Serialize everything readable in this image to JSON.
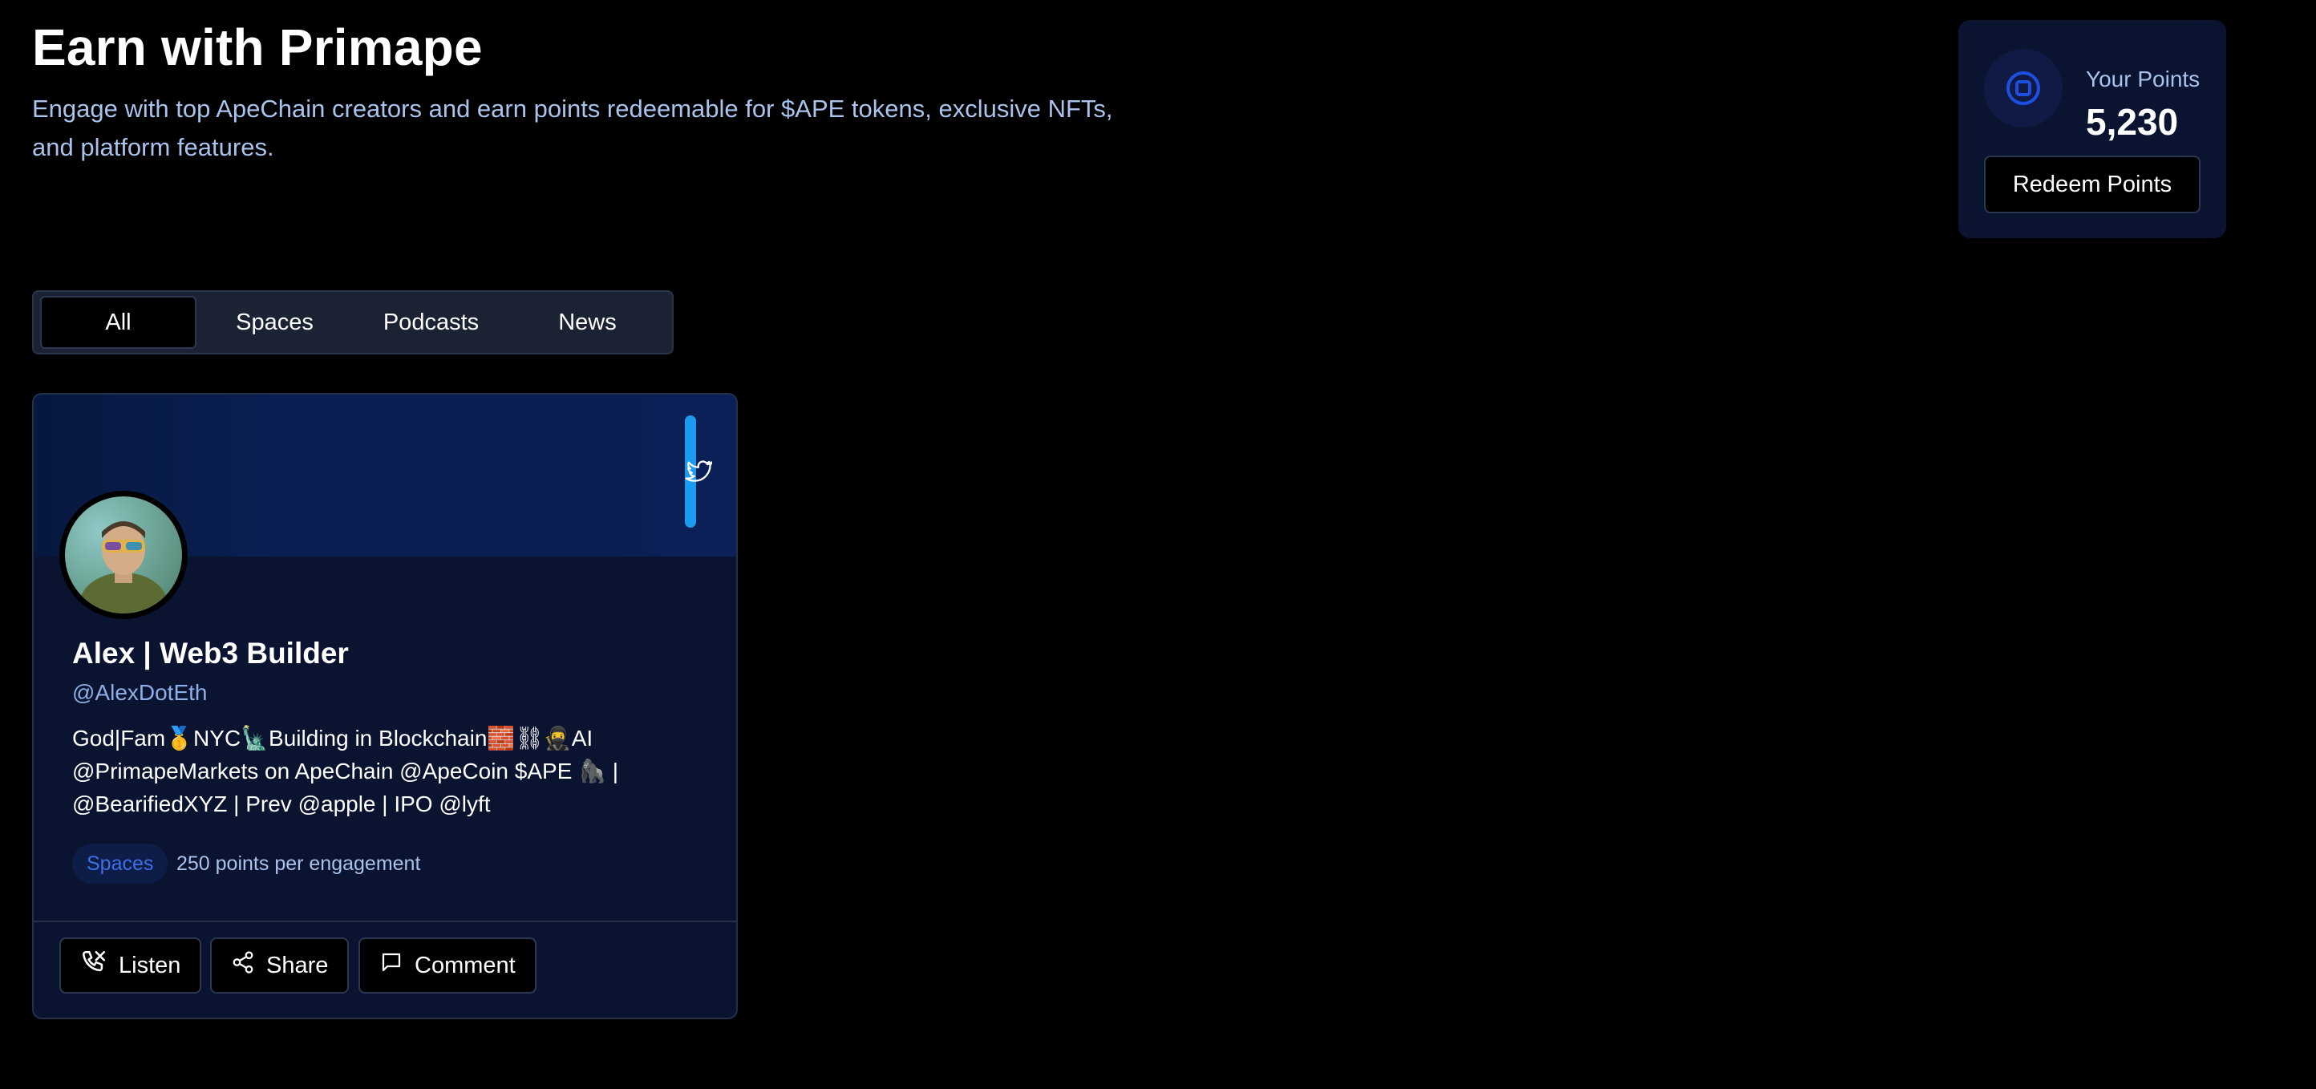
{
  "header": {
    "title": "Earn with Primape",
    "subtitle": "Engage with top ApeChain creators and earn points redeemable for $APE tokens, exclusive NFTs, and platform features."
  },
  "points": {
    "label": "Your Points",
    "value": "5,230",
    "redeem_label": "Redeem Points",
    "icon": "target-icon"
  },
  "tabs": [
    {
      "label": "All",
      "active": true
    },
    {
      "label": "Spaces",
      "active": false
    },
    {
      "label": "Podcasts",
      "active": false
    },
    {
      "label": "News",
      "active": false
    }
  ],
  "creator": {
    "name": "Alex | Web3 Builder",
    "handle": "@AlexDotEth",
    "bio": "God|Fam🥇NYC🗽Building in Blockchain🧱⛓🥷AI @PrimapeMarkets on ApeChain @ApeCoin $APE 🦍 | @BearifiedXYZ | Prev @apple | IPO @lyft",
    "category": "Spaces",
    "points_text": "250 points per engagement",
    "platform_icon": "twitter-icon",
    "actions": [
      {
        "label": "Listen",
        "icon": "phone-icon"
      },
      {
        "label": "Share",
        "icon": "share-icon"
      },
      {
        "label": "Comment",
        "icon": "comment-icon"
      }
    ]
  },
  "colors": {
    "background": "#000000",
    "card": "#0a1330",
    "accent_blue": "#1f4fe0",
    "twitter_blue": "#1d9bf0",
    "subtitle_text": "#a9c3ec"
  }
}
